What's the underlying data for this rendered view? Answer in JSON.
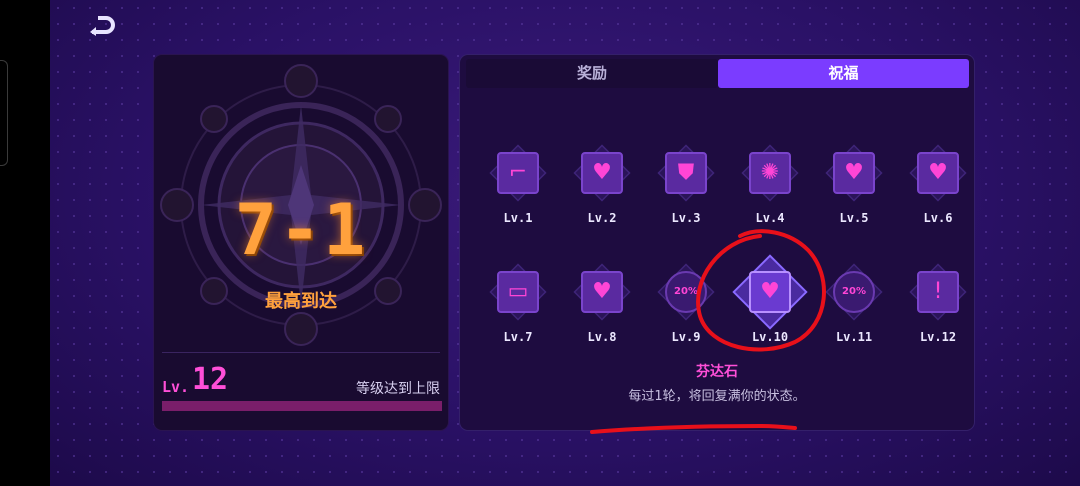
{
  "left": {
    "stage": "7-1",
    "stage_label": "最高到达",
    "level_prefix": "Lv.",
    "level": "12",
    "level_status": "等级达到上限",
    "xp_progress": 1.0
  },
  "tabs": [
    {
      "label": "奖励",
      "active": false
    },
    {
      "label": "祝福",
      "active": true
    }
  ],
  "blessings": [
    {
      "level": "Lv.1",
      "icon": "gun-icon",
      "glyph": "⌐"
    },
    {
      "level": "Lv.2",
      "icon": "heart-plus-icon",
      "glyph": "♥"
    },
    {
      "level": "Lv.3",
      "icon": "shield-icon",
      "glyph": "⛊"
    },
    {
      "level": "Lv.4",
      "icon": "sun-gem-icon",
      "glyph": "✺"
    },
    {
      "level": "Lv.5",
      "icon": "heart-plus-icon",
      "glyph": "♥"
    },
    {
      "level": "Lv.6",
      "icon": "heart-plus-icon",
      "glyph": "♥"
    },
    {
      "level": "Lv.7",
      "icon": "battery-frame-icon",
      "glyph": "▭"
    },
    {
      "level": "Lv.8",
      "icon": "heart-plus-icon",
      "glyph": "♥"
    },
    {
      "level": "Lv.9",
      "icon": "percent-20-icon",
      "glyph": "20%"
    },
    {
      "level": "Lv.10",
      "icon": "shield-heart-icon",
      "glyph": "♥"
    },
    {
      "level": "Lv.11",
      "icon": "percent-20-icon",
      "glyph": "20%"
    },
    {
      "level": "Lv.12",
      "icon": "warning-skull-icon",
      "glyph": "!"
    }
  ],
  "selected": {
    "index": 9,
    "name": "芬达石",
    "description": "每过1轮，将回复满你的状态。"
  },
  "colors": {
    "accent": "#7b3cff",
    "pink": "#ff4fd8",
    "orange": "#ffa13d",
    "annotation": "#e8101a"
  }
}
